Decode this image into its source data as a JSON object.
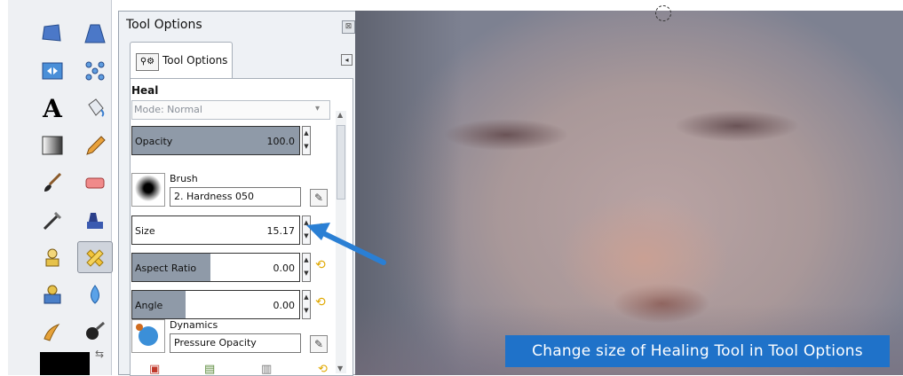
{
  "panel": {
    "title": "Tool Options",
    "close_glyph": "⊠",
    "tab_label": "Tool Options",
    "tab_icon": "⚲⚙",
    "tab_menu_glyph": "◂"
  },
  "tool": {
    "name": "Heal",
    "mode_label": "Mode: Normal"
  },
  "sliders": {
    "opacity": {
      "label": "Opacity",
      "value": "100.0",
      "fraction": 1.0
    },
    "size": {
      "label": "Size",
      "value": "15.17",
      "fraction": 0.0
    },
    "aspect_ratio": {
      "label": "Aspect Ratio",
      "value": "0.00",
      "fraction": 0.47
    },
    "angle": {
      "label": "Angle",
      "value": "0.00",
      "fraction": 0.32
    }
  },
  "brush": {
    "heading": "Brush",
    "name": "2. Hardness 050"
  },
  "dynamics": {
    "heading": "Dynamics",
    "name": "Pressure Opacity"
  },
  "caption": "Change size of Healing Tool in Tool Options",
  "colors": {
    "caption_bg": "#1f72c9",
    "arrow": "#2a7fd4",
    "slider_fill": "#8f9aa8"
  },
  "toolbox_icons": [
    "perspective-icon",
    "unified-transform-icon",
    "flip-icon",
    "cage-transform-icon",
    "text-icon",
    "bucket-fill-icon",
    "blend-icon",
    "pencil-icon",
    "paintbrush-icon",
    "eraser-icon",
    "airbrush-icon",
    "ink-icon",
    "clone-icon",
    "heal-icon",
    "perspective-clone-icon",
    "blur-icon",
    "smudge-icon",
    "dodge-burn-icon"
  ]
}
